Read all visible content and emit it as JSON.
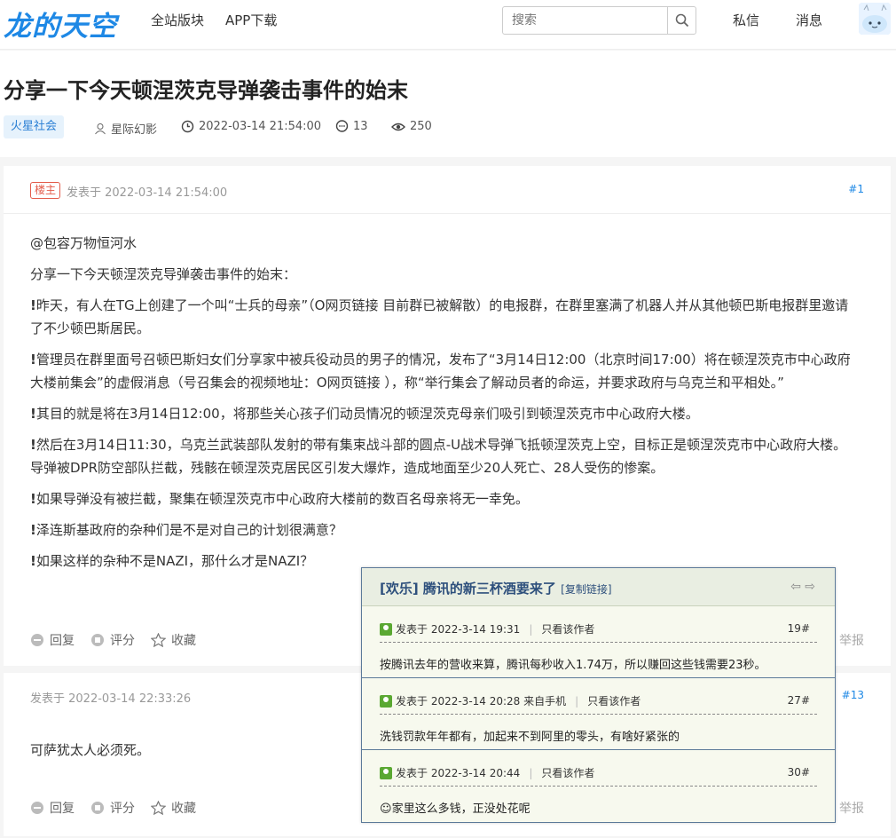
{
  "site": {
    "logo": "龙的天空"
  },
  "nav": {
    "boards": "全站版块",
    "app": "APP下载"
  },
  "search": {
    "placeholder": "搜索"
  },
  "user_nav": {
    "messages": "私信",
    "notifications": "消息"
  },
  "thread": {
    "title": "分享一下今天顿涅茨克导弹袭击事件的始末",
    "tag": "火星社会",
    "author": "星际幻影",
    "date": "2022-03-14 21:54:00",
    "replies": "13",
    "views": "250"
  },
  "post1": {
    "badge": "楼主",
    "time": "发表于 2022-03-14 21:54:00",
    "floor": "#1",
    "mention": "@包容万物恒河水",
    "intro": "分享一下今天顿涅茨克导弹袭击事件的始末：",
    "bullet": "!",
    "paragraphs": [
      "昨天，有人在TG上创建了一个叫“士兵的母亲”（O网页链接 目前群已被解散）的电报群，在群里塞满了机器人并从其他顿巴斯电报群里邀请了不少顿巴斯居民。",
      "管理员在群里面号召顿巴斯妇女们分享家中被兵役动员的男子的情况，发布了“3月14日12:00（北京时间17:00）将在顿涅茨克市中心政府大楼前集会”的虚假消息（号召集会的视频地址：O网页链接 ），称“举行集会了解动员者的命运，并要求政府与乌克兰和平相处。”",
      "其目的就是将在3月14日12:00，将那些关心孩子们动员情况的顿涅茨克母亲们吸引到顿涅茨克市中心政府大楼。",
      "然后在3月14日11:30，乌克兰武装部队发射的带有集束战斗部的圆点-U战术导弹飞抵顿涅茨克上空，目标正是顿涅茨克市中心政府大楼。导弹被DPR防空部队拦截，残骸在顿涅茨克居民区引发大爆炸，造成地面至少20人死亡、28人受伤的惨案。",
      "如果导弹没有被拦截，聚集在顿涅茨克市中心政府大楼前的数百名母亲将无一幸免。",
      "泽连斯基政府的杂种们是不是对自己的计划很满意？",
      "如果这样的杂种不是NAZI，那什么才是NAZI？"
    ]
  },
  "post2": {
    "time": "发表于 2022-03-14 22:33:26",
    "floor": "#13",
    "text": "可萨犹太人必须死。"
  },
  "actions": {
    "reply": "回复",
    "rate": "评分",
    "favorite": "收藏",
    "report": "举报"
  },
  "popup": {
    "title": "[欢乐] 腾讯的新三杯酒要来了",
    "copy": "[复制链接]",
    "items": [
      {
        "meta": "发表于 2022-3-14 19:31",
        "only": "只看该作者",
        "floor": "19#",
        "text": "按腾讯去年的营收来算，腾讯每秒收入1.74万，所以赚回这些钱需要23秒。"
      },
      {
        "meta": "发表于 2022-3-14 20:28 来自手机",
        "only": "只看该作者",
        "floor": "27#",
        "text": "洗钱罚款年年都有，加起来不到阿里的零头，有啥好紧张的"
      },
      {
        "meta": "发表于 2022-3-14 20:44",
        "only": "只看该作者",
        "floor": "30#",
        "text": "家里这么多钱，正没处花呢"
      }
    ]
  }
}
